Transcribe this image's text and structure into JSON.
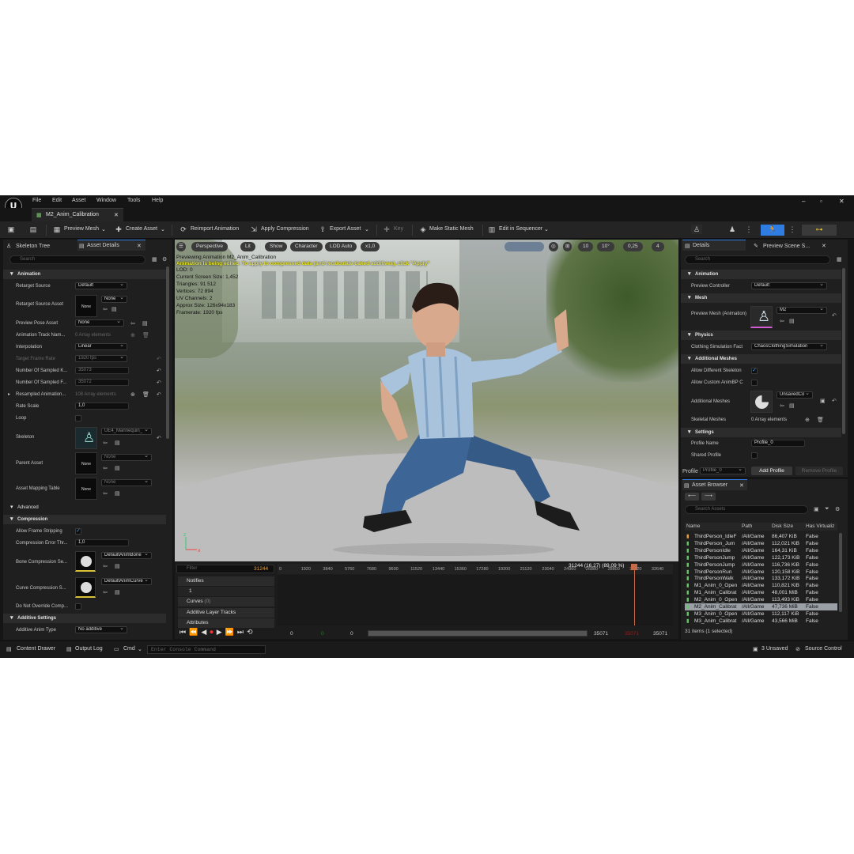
{
  "app": {
    "logo": "U",
    "menu": [
      "File",
      "Edit",
      "Asset",
      "Window",
      "Tools",
      "Help"
    ],
    "tab_title": "M2_Anim_Calibration",
    "window_controls": [
      "–",
      "▫",
      "✕"
    ]
  },
  "toolbar": {
    "preview_mesh": "Preview Mesh",
    "create_asset": "Create Asset",
    "reimport": "Reimport Animation",
    "apply_compression": "Apply Compression",
    "export_asset": "Export Asset",
    "key": "Key",
    "make_static_mesh": "Make Static Mesh",
    "edit_in_sequencer": "Edit in Sequencer"
  },
  "left": {
    "tab_skeleton": "Skeleton Tree",
    "tab_details": "Asset Details",
    "search_placeholder": "Search",
    "sections": {
      "animation": "Animation",
      "advanced": "Advanced",
      "compression": "Compression",
      "additive": "Additive Settings"
    },
    "props": [
      {
        "label": "Retarget Source",
        "value": "Default"
      },
      {
        "label": "Retarget Source Asset",
        "value": "None",
        "thumb": "None"
      },
      {
        "label": "Preview Pose Asset",
        "value": "None"
      },
      {
        "label": "Animation Track Nam...",
        "value": "0 Array elements"
      },
      {
        "label": "Interpolation",
        "value": "Linear"
      },
      {
        "label": "Target Frame Rate",
        "value": "1920 fps"
      },
      {
        "label": "Number Of Sampled K...",
        "value": "35073"
      },
      {
        "label": "Number Of Sampled F...",
        "value": "35072"
      },
      {
        "label": "Resampled Animation...",
        "value": "108 Array elements"
      },
      {
        "label": "Rate Scale",
        "value": "1,0"
      },
      {
        "label": "Loop",
        "value": ""
      },
      {
        "label": "Skeleton",
        "value": "UE4_Mannequin_"
      },
      {
        "label": "Parent Asset",
        "value": "None",
        "thumb": "None"
      },
      {
        "label": "Asset Mapping Table",
        "value": "None",
        "thumb": "None"
      }
    ],
    "compression_props": [
      {
        "label": "Allow Frame Stripping",
        "value": "✓"
      },
      {
        "label": "Compression Error Thr...",
        "value": "1,0"
      },
      {
        "label": "Bone Compression Se...",
        "value": "DefaultAnimBone"
      },
      {
        "label": "Curve Compression S...",
        "value": "DefaultAnimCurve"
      },
      {
        "label": "Do Not Override Comp...",
        "value": ""
      }
    ],
    "additive_type_label": "Additive Anim Type",
    "additive_type_value": "No additive"
  },
  "viewport": {
    "perspective": "Perspective",
    "lit": "Lit",
    "show": "Show",
    "character": "Character",
    "lod": "LOD Auto",
    "speed": "x1,0",
    "grid": "10",
    "angle": "10°",
    "scale": "0,25",
    "cams": "4",
    "info": [
      "Previewing Animation M2_Anim_Calibration",
      "Animation is being edited. To apply to compressed data (and recalculate baked additives), click \"Apply\"",
      "LOD: 0",
      "Current Screen Size: 1,452",
      "Triangles: 91 512",
      "Vertices: 72 894",
      "UV Channels: 2",
      "Approx Size: 126x94x183",
      "Framerate: 1920 fps"
    ]
  },
  "timeline": {
    "filter_placeholder": "Filter",
    "current_frame": "31244",
    "frame_info": "31244 (16,27) (89,09 %)",
    "notifies": "Notifies",
    "notify_track": "1",
    "curves": "Curves",
    "curves_count": "(0)",
    "additive_tracks": "Additive Layer Tracks",
    "attributes": "Attributes",
    "ticks": [
      "0",
      "1920",
      "3840",
      "5760",
      "7680",
      "9600",
      "11520",
      "13440",
      "15360",
      "17280",
      "19200",
      "21120",
      "23040",
      "24960",
      "26880",
      "28800",
      "30720",
      "32640"
    ],
    "start": "0",
    "start2": "0",
    "start3": "0",
    "end": "35071",
    "end2": "35071",
    "end_red": "35071"
  },
  "details": {
    "tab": "Details",
    "tab2": "Preview Scene S...",
    "search_placeholder": "Search",
    "sections": {
      "animation": "Animation",
      "mesh": "Mesh",
      "physics": "Physics",
      "additional": "Additional Meshes",
      "settings": "Settings"
    },
    "preview_controller_label": "Preview Controller",
    "preview_controller": "Default",
    "preview_mesh_label": "Preview Mesh (Animation)",
    "preview_mesh": "M2",
    "clothing_label": "Clothing Simulation Fact",
    "clothing": "ChaosClothingSimulation",
    "allow_diff_label": "Allow Different Skeleton",
    "allow_custom_label": "Allow Custom AnimBP C",
    "additional_meshes_label": "Additional Meshes",
    "additional_meshes": "UnsavedCo",
    "skeletal_meshes_label": "Skeletal Meshes",
    "skeletal_meshes": "0 Array elements",
    "profile_name_label": "Profile Name",
    "profile_name": "Profile_0",
    "shared_profile_label": "Shared Profile",
    "profile_label": "Profile",
    "profile_value": "Profile_0",
    "add_profile": "Add Profile",
    "remove_profile": "Remove Profile"
  },
  "asset_browser": {
    "tab": "Asset Browser",
    "search_placeholder": "Search Assets",
    "headers": [
      "Name",
      "Path",
      "Disk Size",
      "Has Virtualiz"
    ],
    "rows": [
      [
        "ThirdPerson_IdleF",
        "/All/Game",
        "86,407 KiB",
        "False"
      ],
      [
        "ThirdPerson_Jum",
        "/All/Game",
        "112,021 KiB",
        "False"
      ],
      [
        "ThirdPersonIdle",
        "/All/Game",
        "164,31 KiB",
        "False"
      ],
      [
        "ThirdPersonJump",
        "/All/Game",
        "122,173 KiB",
        "False"
      ],
      [
        "ThirdPersonJump",
        "/All/Game",
        "116,736 KiB",
        "False"
      ],
      [
        "ThirdPersonRun",
        "/All/Game",
        "120,158 KiB",
        "False"
      ],
      [
        "ThirdPersonWalk",
        "/All/Game",
        "133,172 KiB",
        "False"
      ],
      [
        "M1_Anim_0_Open",
        "/All/Game",
        "110,821 KiB",
        "False"
      ],
      [
        "M1_Anim_Calibrat",
        "/All/Game",
        "48,001 MiB",
        "False"
      ],
      [
        "M2_Anim_0_Open",
        "/All/Game",
        "113,493 KiB",
        "False"
      ],
      [
        "M2_Anim_Calibrat",
        "/All/Game",
        "47,736 MiB",
        "False"
      ],
      [
        "M3_Anim_0_Open",
        "/All/Game",
        "112,117 KiB",
        "False"
      ],
      [
        "M3_Anim_Calibrat",
        "/All/Game",
        "43,566 MiB",
        "False"
      ]
    ],
    "selected_index": 10,
    "count": "31 items (1 selected)"
  },
  "status": {
    "content_drawer": "Content Drawer",
    "output_log": "Output Log",
    "cmd": "Cmd",
    "console_placeholder": "Enter Console Command",
    "unsaved": "3 Unsaved",
    "source_control": "Source Control"
  },
  "colors": {
    "accent": "#2f7de1",
    "bg": "#151515",
    "panel": "#1f1f1f",
    "section": "#2c2c2c",
    "selected_row": "#9aa0a6",
    "timeline_marker": "#c66a4a"
  }
}
